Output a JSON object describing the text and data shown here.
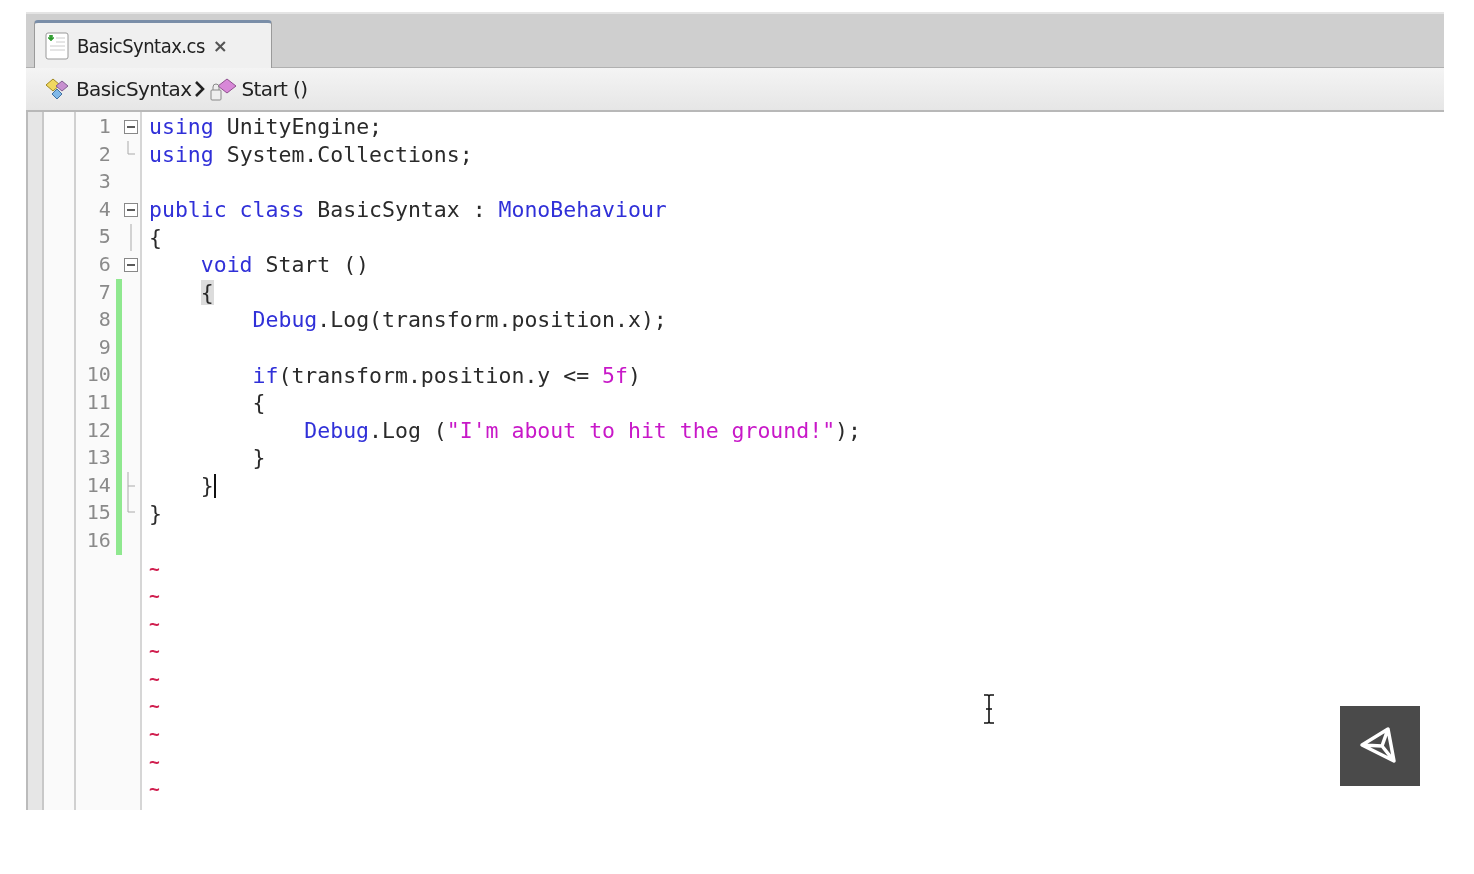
{
  "tabs": [
    {
      "label": "BasicSyntax.cs",
      "close": "×",
      "selected": true
    }
  ],
  "breadcrumb": [
    {
      "label": "BasicSyntax",
      "kind": "class"
    },
    {
      "label": "Start ()",
      "kind": "method"
    }
  ],
  "lines": [
    {
      "number": "1",
      "kind": "fold-open",
      "modified": false,
      "cursor": false,
      "tokens": [
        {
          "text": "using",
          "kind": "keyword"
        },
        {
          "text": " UnityEngine;",
          "kind": "plain"
        }
      ]
    },
    {
      "number": "2",
      "kind": "fold-end",
      "modified": false,
      "cursor": false,
      "tokens": [
        {
          "text": "using",
          "kind": "keyword"
        },
        {
          "text": " System.Collections;",
          "kind": "plain"
        }
      ]
    },
    {
      "number": "3",
      "modified": false,
      "cursor": false
    },
    {
      "number": "4",
      "kind": "fold-open",
      "modified": false,
      "cursor": false,
      "tokens": [
        {
          "text": "public class",
          "kind": "keyword"
        },
        {
          "text": " BasicSyntax : ",
          "kind": "plain"
        },
        {
          "text": "MonoBehaviour",
          "kind": "keyword"
        }
      ]
    },
    {
      "number": "5",
      "kind": "fold-line",
      "modified": false,
      "cursor": false,
      "tokens": [
        {
          "text": "{",
          "kind": "plain"
        }
      ]
    },
    {
      "number": "6",
      "kind": "fold-open",
      "modified": false,
      "cursor": false,
      "tokens": [
        {
          "text": "    void",
          "kind": "keyword"
        },
        {
          "text": " Start ()",
          "kind": "plain"
        }
      ]
    },
    {
      "number": "7",
      "modified": true,
      "cursor": false,
      "tokens": [
        {
          "text": "    {",
          "kind": "match"
        }
      ]
    },
    {
      "number": "8",
      "modified": true,
      "cursor": false,
      "tokens": [
        {
          "text": "        Debug",
          "kind": "keyword"
        },
        {
          "text": ".Log(transform.position.x);",
          "kind": "plain"
        }
      ]
    },
    {
      "number": "9",
      "modified": true,
      "cursor": false
    },
    {
      "number": "10",
      "modified": true,
      "cursor": false,
      "tokens": [
        {
          "text": "        if",
          "kind": "keyword"
        },
        {
          "text": "(transform.position.y <= ",
          "kind": "plain"
        },
        {
          "text": "5f",
          "kind": "literal"
        },
        {
          "text": ")",
          "kind": "plain"
        }
      ]
    },
    {
      "number": "11",
      "modified": true,
      "cursor": false,
      "tokens": [
        {
          "text": "        {",
          "kind": "plain"
        }
      ]
    },
    {
      "number": "12",
      "modified": true,
      "cursor": false,
      "tokens": [
        {
          "text": "            Debug",
          "kind": "keyword"
        },
        {
          "text": ".Log (",
          "kind": "plain"
        },
        {
          "text": "\"I'm about to hit the ground!\"",
          "kind": "literal"
        },
        {
          "text": ");",
          "kind": "plain"
        }
      ]
    },
    {
      "number": "13",
      "modified": true,
      "cursor": false,
      "tokens": [
        {
          "text": "        }",
          "kind": "plain"
        }
      ]
    },
    {
      "number": "14",
      "kind": "fold-tick",
      "modified": true,
      "cursor": true,
      "tokens": [
        {
          "text": "    }",
          "kind": "plain"
        }
      ]
    },
    {
      "number": "15",
      "kind": "fold-end",
      "modified": true,
      "cursor": false,
      "tokens": [
        {
          "text": "}",
          "kind": "plain"
        }
      ]
    },
    {
      "number": "16",
      "modified": true,
      "cursor": false
    }
  ],
  "tildes": [
    "~",
    "~",
    "~",
    "~",
    "~",
    "~",
    "~",
    "~",
    "~"
  ]
}
